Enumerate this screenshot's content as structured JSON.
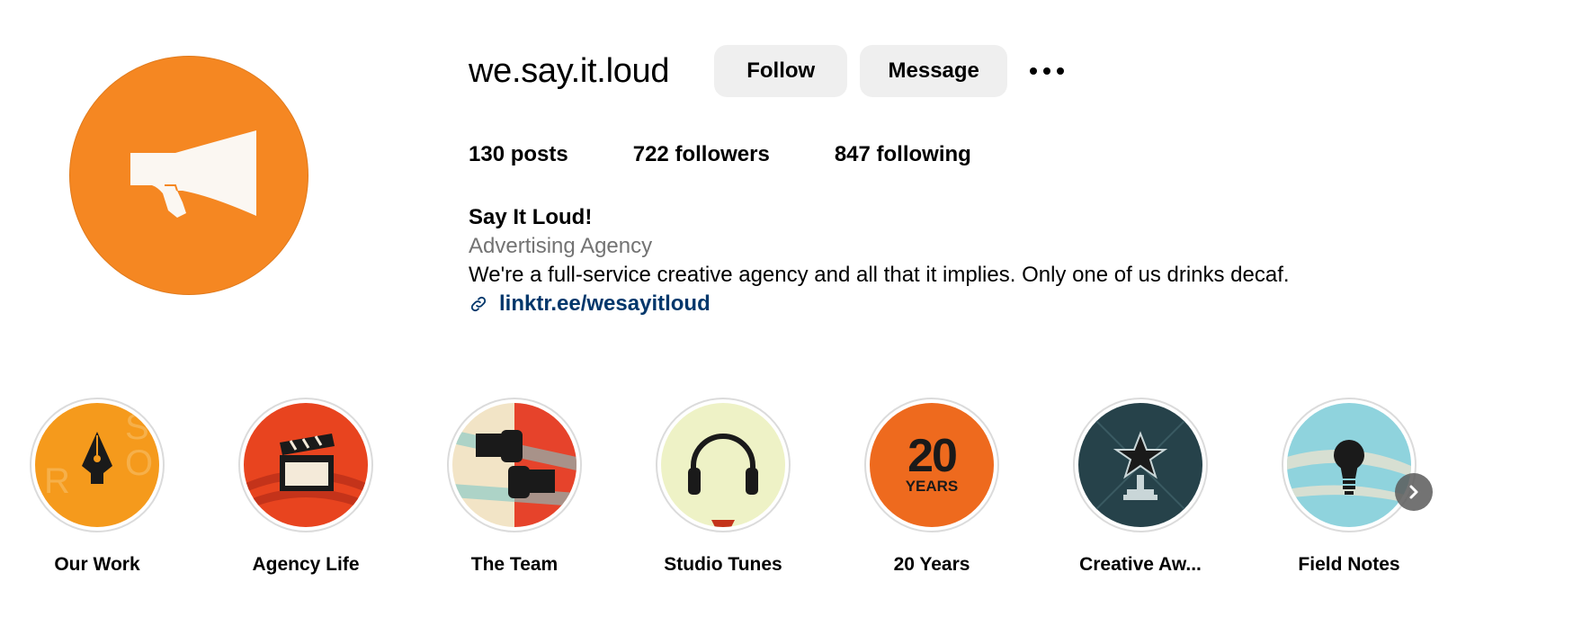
{
  "profile": {
    "username": "we.say.it.loud",
    "follow_label": "Follow",
    "message_label": "Message",
    "more_icon": "more-horizontal-icon",
    "avatar_color": "#f58722"
  },
  "stats": {
    "posts_count": "130",
    "posts_label": "posts",
    "followers_count": "722",
    "followers_label": "followers",
    "following_count": "847",
    "following_label": "following"
  },
  "bio": {
    "name": "Say It Loud!",
    "category": "Advertising Agency",
    "description": "We're a full-service creative agency and all that it implies. Only one of us drinks decaf.",
    "link": "linktr.ee/wesayitloud",
    "link_color": "#00376b"
  },
  "highlights": [
    {
      "label": "Our Work",
      "icon": "pen-nib-icon",
      "color": "#f59a1c"
    },
    {
      "label": "Agency Life",
      "icon": "clapperboard-icon",
      "color": "#e8441f"
    },
    {
      "label": "The Team",
      "icon": "fist-bump-icon",
      "color": "#f2e4c6"
    },
    {
      "label": "Studio Tunes",
      "icon": "headphones-icon",
      "color": "#eef2c6"
    },
    {
      "label": "20 Years",
      "icon": "twenty-years-icon",
      "color": "#ee6a1e",
      "badge_number": "20",
      "badge_text": "YEARS"
    },
    {
      "label": "Creative Aw...",
      "icon": "trophy-star-icon",
      "color": "#26424a"
    },
    {
      "label": "Field Notes",
      "icon": "lightbulb-icon",
      "color": "#8fd3dd"
    }
  ],
  "next_icon": "chevron-right-icon"
}
